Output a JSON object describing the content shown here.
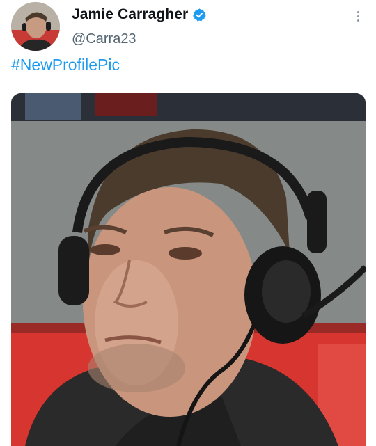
{
  "author": {
    "display_name": "Jamie Carragher",
    "handle": "@Carra23",
    "verified_icon": "verified-badge-icon",
    "avatar_icon": "profile-avatar"
  },
  "tweet": {
    "text": "#NewProfilePic"
  },
  "menu": {
    "icon": "more-options-icon"
  },
  "media": {
    "description_icon": "photo-man-with-headset"
  },
  "colors": {
    "link": "#1d9bf0",
    "verified": "#1d9bf0",
    "secondary_text": "#536471",
    "primary_text": "#0f1419"
  }
}
